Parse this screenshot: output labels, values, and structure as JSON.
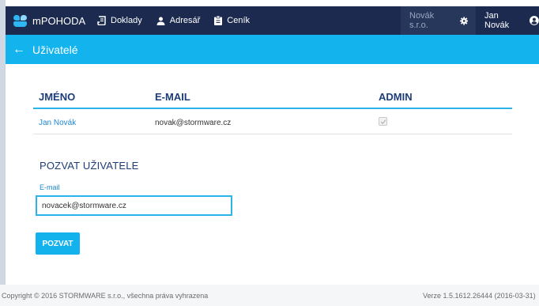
{
  "app": {
    "name": "mPOHODA"
  },
  "nav": {
    "items": [
      {
        "label": "Doklady",
        "icon": "receipt-icon"
      },
      {
        "label": "Adresář",
        "icon": "person-icon"
      },
      {
        "label": "Ceník",
        "icon": "clipboard-icon"
      }
    ],
    "company": "Novák s.r.o.",
    "user": "Jan Novák"
  },
  "subheader": {
    "title": "Uživatelé",
    "back_icon": "arrow-left-icon"
  },
  "users_table": {
    "headers": [
      "JMÉNO",
      "E-MAIL",
      "ADMIN"
    ],
    "rows": [
      {
        "name": "Jan Novák",
        "email": "novak@stormware.cz",
        "admin": true
      }
    ]
  },
  "invite": {
    "title": "POZVAT UŽIVATELE",
    "email_label": "E-mail",
    "email_value": "novacek@stormware.cz",
    "button_label": "POZVAT"
  },
  "footer": {
    "copyright": "Copyright © 2016 STORMWARE s.r.o., všechna práva vyhrazena",
    "version": "Verze 1.5.1612.26444 (2016-03-31)"
  },
  "colors": {
    "navbar": "#1b2a4e",
    "subheader": "#13b4ee",
    "accent": "#2bb3ea",
    "heading": "#1e3c78",
    "link": "#1e88d2"
  }
}
